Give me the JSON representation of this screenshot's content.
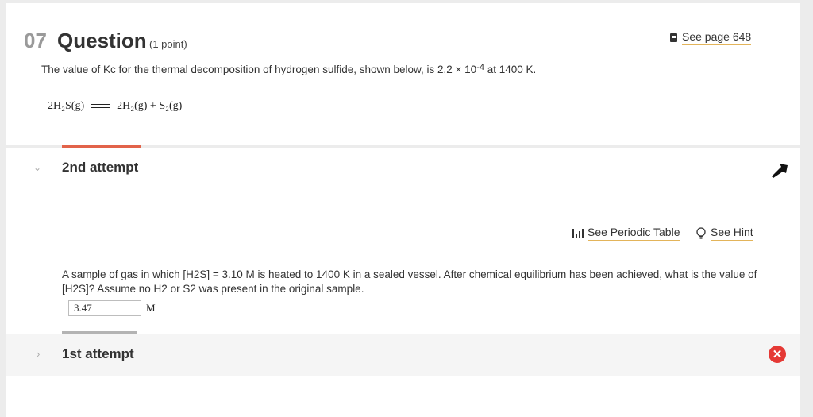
{
  "question": {
    "number": "07",
    "title": "Question",
    "points": "(1 point)",
    "see_page": "See page 648",
    "prompt_before": "The value of Kc for the thermal decomposition of hydrogen sulfide, shown below, is 2.2 × 10",
    "prompt_exp": "-4",
    "prompt_after": " at 1400 K.",
    "equation": {
      "left": "2H₂S(g)",
      "right": "2H₂(g) + S₂(g)"
    }
  },
  "attempt2": {
    "label": "2nd attempt",
    "periodic_table": "See Periodic Table",
    "hint": "See Hint",
    "text": "A sample of gas in which [H2S] = 3.10 M is heated to 1400 K in a sealed vessel. After chemical equilibrium has been achieved, what is the value of [H2S]? Assume no H2 or S2 was present in the original sample.",
    "answer": "3.47",
    "unit": "M"
  },
  "attempt1": {
    "label": "1st attempt"
  },
  "colors": {
    "accent_red": "#e2634a",
    "wrong": "#e53935",
    "link_underline": "#e3b45a"
  }
}
